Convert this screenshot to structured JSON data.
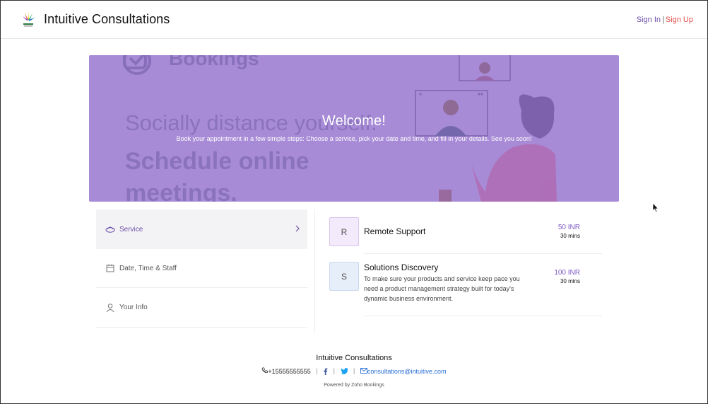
{
  "header": {
    "brand": "Intuitive Consultations",
    "sign_in": "Sign In",
    "separator": "|",
    "sign_up": "Sign Up"
  },
  "banner": {
    "title": "Welcome!",
    "subtitle": "Book your appointment in a few simple steps: Choose a service, pick your date and time, and fill in your details. See you soon!",
    "art_text": {
      "bookings": "Bookings",
      "line1": "Socially distance yourself.",
      "line2": "Schedule online",
      "line3": "meetings."
    },
    "color": "#a88bd6"
  },
  "steps": [
    {
      "label": "Service",
      "icon": "service-icon",
      "active": true
    },
    {
      "label": "Date, Time & Staff",
      "icon": "calendar-icon",
      "active": false
    },
    {
      "label": "Your Info",
      "icon": "user-icon",
      "active": false
    }
  ],
  "services": [
    {
      "initial": "R",
      "name": "Remote Support",
      "description": "",
      "price": "50 INR",
      "duration": "30 mins"
    },
    {
      "initial": "S",
      "name": "Solutions Discovery",
      "description": "To make sure your products and service keep pace you need a product management strategy built for today's dynamic business environment.",
      "price": "100 INR",
      "duration": "30 mins"
    }
  ],
  "footer": {
    "title": "Intuitive Consultations",
    "phone": "+15555555555",
    "email": "consultations@intuitive.com",
    "powered_by": "Powered by Zoho Bookings",
    "separator": "|"
  },
  "colors": {
    "accent": "#7b58c4",
    "sign_up": "#e0504a",
    "link": "#2a6fd6"
  }
}
